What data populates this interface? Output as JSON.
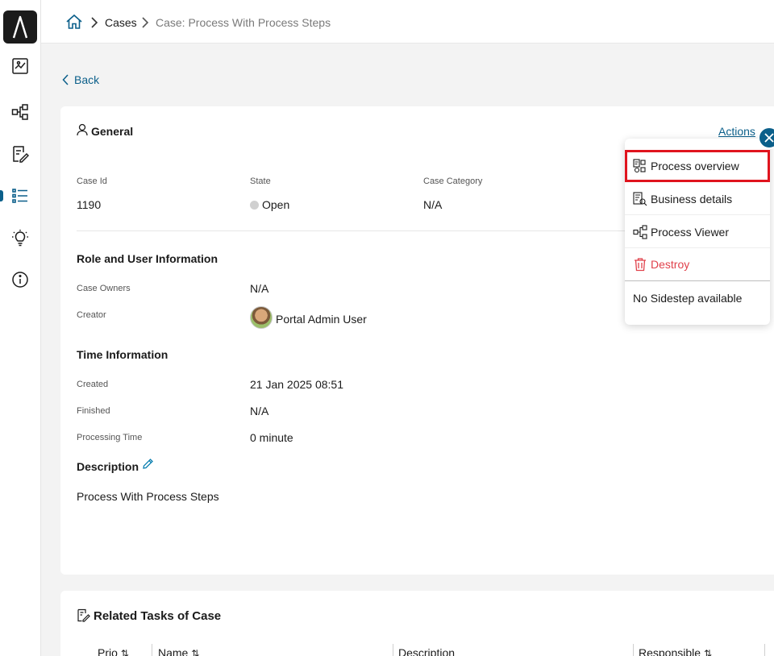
{
  "breadcrumb": {
    "cases": "Cases",
    "current": "Case: Process With Process Steps"
  },
  "back_label": "Back",
  "general": {
    "title": "General",
    "actions_label": "Actions",
    "fields": {
      "case_id_label": "Case Id",
      "case_id_value": "1190",
      "state_label": "State",
      "state_value": "Open",
      "category_label": "Case Category",
      "category_value": "N/A"
    },
    "role_section": {
      "title": "Role and User Information",
      "owners_label": "Case Owners",
      "owners_value": "N/A",
      "creator_label": "Creator",
      "creator_value": "Portal Admin User"
    },
    "time_section": {
      "title": "Time Information",
      "created_label": "Created",
      "created_value": "21 Jan 2025 08:51",
      "finished_label": "Finished",
      "finished_value": "N/A",
      "processing_label": "Processing Time",
      "processing_value": "0 minute"
    },
    "description_section": {
      "title": "Description",
      "value": "Process With Process Steps"
    }
  },
  "actions_menu": {
    "items": [
      {
        "label": "Process overview",
        "icon": "process-overview-icon"
      },
      {
        "label": "Business details",
        "icon": "business-details-icon"
      },
      {
        "label": "Process Viewer",
        "icon": "process-viewer-icon"
      },
      {
        "label": "Destroy",
        "icon": "trash-icon"
      }
    ],
    "no_sidestep": "No Sidestep available"
  },
  "related_tasks": {
    "title": "Related Tasks of Case",
    "columns": [
      "Prio",
      "Name",
      "Description",
      "Responsible"
    ]
  },
  "colors": {
    "accent": "#0b5f8a",
    "danger": "#e0414b",
    "highlight": "#e0141e"
  }
}
